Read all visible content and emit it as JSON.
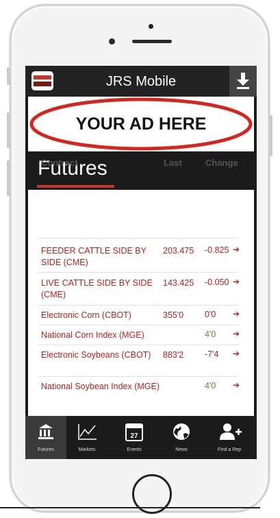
{
  "app": {
    "title": "JRS Mobile"
  },
  "ad": {
    "text": "YOUR AD HERE"
  },
  "section": {
    "title": "Futures"
  },
  "table": {
    "headers": {
      "contract": "Contract",
      "last": "Last",
      "change": "Change"
    },
    "rows": [
      {
        "contract": "FEEDER CATTLE SIDE BY SIDE (CME)",
        "last": "203.475",
        "change": "-0.825",
        "direction": "negative"
      },
      {
        "contract": "LIVE CATTLE SIDE BY SIDE (CME)",
        "last": "143.425",
        "change": "-0.050",
        "direction": "negative"
      },
      {
        "contract": "Electronic Corn (CBOT)",
        "last": "355'0",
        "change": "0'0",
        "direction": "negative"
      },
      {
        "contract": "National Corn Index (MGE)",
        "last": "",
        "change": "4'0",
        "direction": "positive"
      },
      {
        "contract": "Electronic Soybeans (CBOT)",
        "last": "883'2",
        "change": "-7'4",
        "direction": "negative"
      },
      {
        "contract": "National Soybean Index (MGE)",
        "last": "",
        "change": "4'0",
        "direction": "positive"
      }
    ]
  },
  "tabs": [
    {
      "label": "Futures",
      "icon": "bank-icon",
      "active": true
    },
    {
      "label": "Markets",
      "icon": "chart-icon",
      "active": false
    },
    {
      "label": "Events",
      "icon": "calendar-icon",
      "calendar_day": "27",
      "active": false
    },
    {
      "label": "News",
      "icon": "globe-icon",
      "active": false
    },
    {
      "label": "Find a Rep",
      "icon": "add-person-icon",
      "active": false
    }
  ],
  "colors": {
    "accent": "#c0392b",
    "positive": "#4c9a2a",
    "negative": "#b5231c",
    "bar": "#1b1b1b"
  }
}
